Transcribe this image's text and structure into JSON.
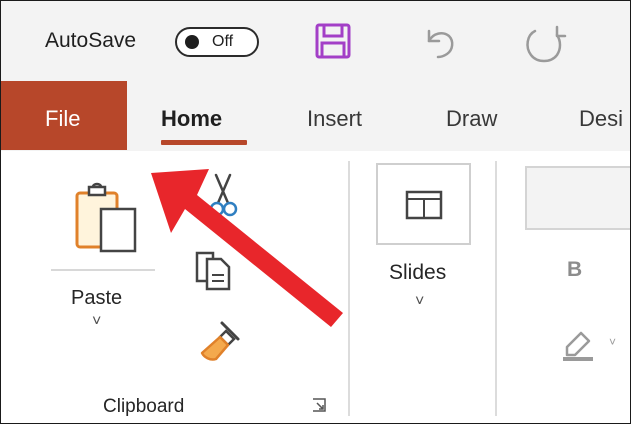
{
  "quick_access": {
    "autosave_label": "AutoSave",
    "autosave_state": "Off",
    "save_icon": "save-icon",
    "undo_icon": "undo-icon",
    "redo_icon": "redo-icon"
  },
  "tabs": {
    "file": "File",
    "home": "Home",
    "insert": "Insert",
    "draw": "Draw",
    "design": "Desi",
    "active": "Home"
  },
  "clipboard_group": {
    "paste_label": "Paste",
    "group_label": "Clipboard",
    "chevron": "˅",
    "copy_chevron": "˅"
  },
  "slides_group": {
    "slides_label": "Slides",
    "chevron": "˅"
  },
  "font_group": {
    "bold_label": "B",
    "highlight_chevron": "˅"
  },
  "colors": {
    "file_tab": "#b7472a",
    "home_underline": "#b7472a",
    "save_icon": "#a33fc7",
    "annotation_arrow": "#e8262b",
    "painter_icon": "#e0812a"
  }
}
